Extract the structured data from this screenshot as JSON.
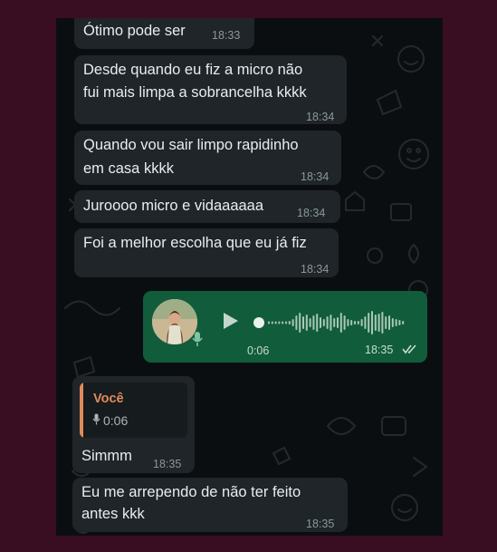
{
  "messages": [
    {
      "text": "Ótimo pode ser",
      "time": "18:33"
    },
    {
      "line1": "Desde quando eu fiz a micro não",
      "line2": "fui mais limpa a sobrancelha  kkkk",
      "time": "18:34"
    },
    {
      "line1": "Quando vou sair limpo rapidinho",
      "line2": "em casa kkkk",
      "time": "18:34"
    },
    {
      "text": "Juroooo micro e vidaaaaaa",
      "time": "18:34"
    },
    {
      "text": "Foi a melhor escolha que eu já fiz",
      "time": "18:34"
    }
  ],
  "voice_message": {
    "duration": "0:06",
    "time": "18:35",
    "status_icon": "double-check-icon",
    "progress": 0
  },
  "reply_message": {
    "quoted_author": "Você",
    "quoted_duration": "0:06",
    "text": "Simmm",
    "time": "18:35"
  },
  "last_message": {
    "line1": "Eu me arrependo  de não ter feito",
    "line2": "antes  kkk",
    "time": "18:35"
  },
  "colors": {
    "frame_background": "#3a0e22",
    "chat_background": "#0b0e10",
    "incoming_bubble": "#1f2528",
    "outgoing_bubble": "#115c3b",
    "reply_accent": "#e08a5c"
  }
}
